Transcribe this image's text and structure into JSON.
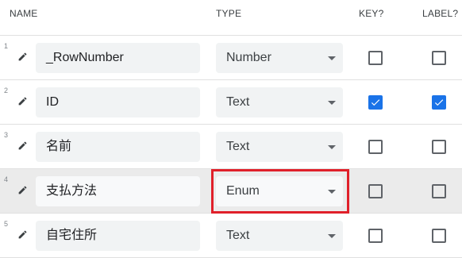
{
  "header": {
    "name": "NAME",
    "type": "TYPE",
    "key": "KEY?",
    "label": "LABEL?"
  },
  "rows": [
    {
      "num": "1",
      "name": "_RowNumber",
      "type": "Number",
      "key": false,
      "label": false
    },
    {
      "num": "2",
      "name": "ID",
      "type": "Text",
      "key": true,
      "label": true
    },
    {
      "num": "3",
      "name": "名前",
      "type": "Text",
      "key": false,
      "label": false
    },
    {
      "num": "4",
      "name": "支払方法",
      "type": "Enum",
      "key": false,
      "label": false
    },
    {
      "num": "5",
      "name": "自宅住所",
      "type": "Text",
      "key": false,
      "label": false
    }
  ],
  "selected_row": "4",
  "icons": {
    "edit": "pencil-icon",
    "dropdown": "caret-down-icon",
    "check": "checkmark-icon"
  },
  "colors": {
    "checkbox_checked": "#1a73e8",
    "highlight": "#e0202a",
    "selected_row_bg": "#ebebeb"
  }
}
